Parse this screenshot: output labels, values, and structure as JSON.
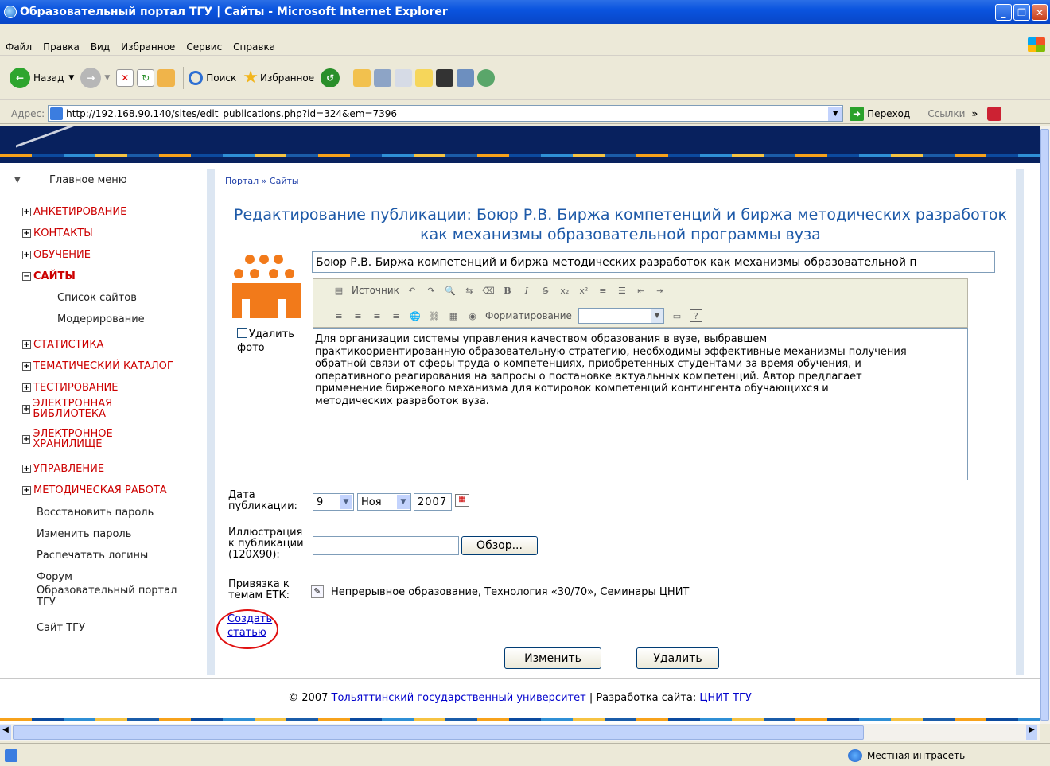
{
  "window": {
    "title": "Образовательный портал ТГУ | Сайты - Microsoft Internet Explorer"
  },
  "menu": [
    "Файл",
    "Правка",
    "Вид",
    "Избранное",
    "Сервис",
    "Справка"
  ],
  "toolbar": {
    "back": "Назад",
    "search": "Поиск",
    "favorites": "Избранное"
  },
  "address": {
    "label": "Адрес:",
    "url": "http://192.168.90.140/sites/edit_publications.php?id=324&em=7396",
    "go": "Переход",
    "links": "Ссылки"
  },
  "sidebar": {
    "title": "Главное меню",
    "items": [
      "АНКЕТИРОВАНИЕ",
      "КОНТАКТЫ",
      "ОБУЧЕНИЕ",
      "САЙТЫ",
      "СТАТИСТИКА",
      "ТЕМАТИЧЕСКИЙ КАТАЛОГ",
      "ТЕСТИРОВАНИЕ",
      "ЭЛЕКТРОННАЯ БИБЛИОТЕКА",
      "ЭЛЕКТРОННОЕ ХРАНИЛИЩЕ",
      "УПРАВЛЕНИЕ",
      "МЕТОДИЧЕСКАЯ РАБОТА"
    ],
    "sub_items": [
      "Список сайтов",
      "Модерирование"
    ],
    "links": [
      "Восстановить пароль",
      "Изменить пароль",
      "Распечатать логины",
      "Форум",
      "Образовательный портал ТГУ",
      "Сайт ТГУ"
    ]
  },
  "breadcrumb": {
    "portal": "Портал",
    "sep": "»",
    "sites": "Сайты"
  },
  "page": {
    "title": "Редактирование публикации: Боюр Р.В. Биржа компетенций и биржа методических разработок как механизмы образовательной программы вуза",
    "title_value": "Боюр Р.В. Биржа компетенций и биржа методических разработок как механизмы образовательной п",
    "delete_photo": "Удалить фото",
    "body": "Для организации системы управления качеством образования в вузе, выбравшем\nпрактикоориентированную образовательную стратегию, необходимы эффективные механизмы получения\nобратной связи от сферы труда о компетенциях, приобретенных студентами за время обучения, и\nоперативного реагирования на запросы о постановке актуальных компетенций. Автор предлагает\nприменение биржевого механизма для котировок компетенций контингента обучающихся и\nметодических разработок вуза.",
    "date_label": "Дата публикации:",
    "date_day": "9",
    "date_month": "Ноя",
    "date_year": "2007",
    "illustration_label": "Иллюстрация к публикации (120X90):",
    "browse": "Обзор...",
    "etk_label": "Привязка к темам ЕТК:",
    "etk_value": "Непрерывное образование, Технология «30/70», Семинары ЦНИТ",
    "create_article": "Создать статью",
    "change": "Изменить",
    "delete": "Удалить"
  },
  "editor": {
    "source": "Источник",
    "format": "Форматирование"
  },
  "footer": {
    "copy": "© 2007",
    "university": "Тольяттинский государственный университет",
    "dev": "| Разработка сайта:",
    "dev_link": "ЦНИТ ТГУ"
  },
  "status": {
    "zone": "Местная интрасеть"
  }
}
